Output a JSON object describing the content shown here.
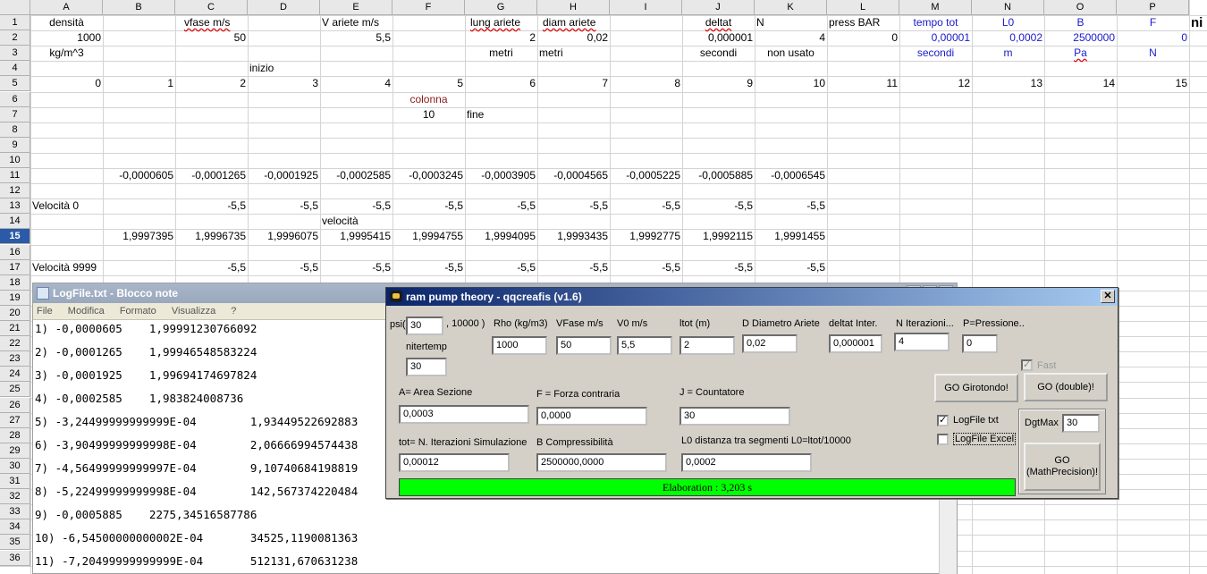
{
  "sheet": {
    "col_headers": [
      "A",
      "B",
      "C",
      "D",
      "E",
      "F",
      "G",
      "H",
      "I",
      "J",
      "K",
      "L",
      "M",
      "N",
      "O",
      "P"
    ],
    "row_headers": [
      "1",
      "2",
      "3",
      "4",
      "5",
      "6",
      "7",
      "8",
      "9",
      "10",
      "11",
      "12",
      "13",
      "14",
      "15",
      "16",
      "17",
      "18",
      "19",
      "20",
      "21",
      "22",
      "23",
      "24",
      "25",
      "26",
      "27",
      "28",
      "29",
      "30",
      "31",
      "32",
      "33",
      "34",
      "35",
      "36"
    ],
    "selected_row": "15",
    "r1": {
      "a": "densità",
      "c": "vfase m/s",
      "e": "V ariete m/s",
      "g": "lung ariete",
      "h": "diam ariete",
      "j": "deltat",
      "k": "N",
      "l": "press BAR",
      "m": "tempo tot",
      "n": "L0",
      "o": "B",
      "p": "F",
      "q": "ni"
    },
    "r2": {
      "a": "1000",
      "c": "50",
      "e": "5,5",
      "g": "2",
      "h": "0,02",
      "j": "0,000001",
      "k": "4",
      "l": "0",
      "m": "0,00001",
      "n": "0,0002",
      "o": "2500000",
      "p": "0"
    },
    "r3": {
      "a": "kg/m^3",
      "g": "metri",
      "h": "metri",
      "j": "secondi",
      "k": "non usato",
      "m": "secondi",
      "n": "m",
      "o": "Pa",
      "p": "N"
    },
    "r4": {
      "d": "inizio"
    },
    "r5": [
      "0",
      "1",
      "2",
      "3",
      "4",
      "5",
      "6",
      "7",
      "8",
      "9",
      "10",
      "11",
      "12",
      "13",
      "14",
      "15"
    ],
    "r6": {
      "f": "colonna"
    },
    "r7": {
      "f": "10",
      "g": "fine"
    },
    "r11": [
      "-0,0000605",
      "-0,0001265",
      "-0,0001925",
      "-0,0002585",
      "-0,0003245",
      "-0,0003905",
      "-0,0004565",
      "-0,0005225",
      "-0,0005885",
      "-0,0006545"
    ],
    "r13": {
      "label": "Velocità 0",
      "values": [
        "-5,5",
        "-5,5",
        "-5,5",
        "-5,5",
        "-5,5",
        "-5,5",
        "-5,5",
        "-5,5",
        "-5,5"
      ]
    },
    "r14": {
      "e": "velocità"
    },
    "r15": [
      "1,9997395",
      "1,9996735",
      "1,9996075",
      "1,9995415",
      "1,9994755",
      "1,9994095",
      "1,9993435",
      "1,9992775",
      "1,9992115",
      "1,9991455"
    ],
    "r17": {
      "label": "Velocità 9999",
      "values": [
        "-5,5",
        "-5,5",
        "-5,5",
        "-5,5",
        "-5,5",
        "-5,5",
        "-5,5",
        "-5,5",
        "-5,5"
      ]
    }
  },
  "notepad": {
    "title": "LogFile.txt - Blocco note",
    "menu": [
      "File",
      "Modifica",
      "Formato",
      "Visualizza",
      "?"
    ],
    "lines": [
      "1) -0,0000605    1,99991230766092",
      "2) -0,0001265    1,99946548583224",
      "3) -0,0001925    1,99694174697824",
      "4) -0,0002585    1,983824008736",
      "5) -3,24499999999999E-04        1,93449522692883",
      "6) -3,90499999999998E-04        2,06666994574438",
      "7) -4,56499999999997E-04        9,10740684198819",
      "8) -5,22499999999998E-04        142,567374220484",
      "9) -0,0005885    2275,34516587786",
      "10) -6,54500000000002E-04       34525,1190081363",
      "11) -7,20499999999999E-04       512131,670631238"
    ]
  },
  "dialog": {
    "title": "ram pump theory - qqcreafis (v1.6)",
    "close": "✕",
    "psi_label": "psi(",
    "psi_value": "30",
    "psi_suffix": ", 10000  )",
    "nitertemp_label": "nitertemp",
    "nitertemp_value": "30",
    "rho_label": "Rho  (kg/m3)",
    "rho_value": "1000",
    "vfase_label": "VFase m/s",
    "vfase_value": "50",
    "v0_label": "V0 m/s",
    "v0_value": "5,5",
    "ltot_label": "ltot (m)",
    "ltot_value": "2",
    "diam_label": "D Diametro Ariete",
    "diam_value": "0,02",
    "deltat_label": "deltat  Inter.",
    "deltat_value": "0,000001",
    "niter_label": "N Iterazioni...",
    "niter_value": "4",
    "press_label": "P=Pressione..",
    "press_value": "0",
    "fast_label": "Fast",
    "area_label": "A= Area Sezione",
    "area_value": "0,0003",
    "forza_label": "F = Forza contraria",
    "forza_value": "0,0000",
    "count_label": "J = Countatore",
    "count_value": "30",
    "tot_label": "tot= N.  Iterazioni Simulazione",
    "tot_value": "0,00012",
    "compr_label": "B Compressibilità",
    "compr_value": "2500000,0000",
    "l0_label": "L0 distanza tra segmenti L0=ltot/10000",
    "l0_value": "0,0002",
    "go_girotondo": "GO Girotondo!",
    "go_double": "GO (double)!",
    "logtxt_label": "LogFile txt",
    "logexcel_label": "LogFile Excel",
    "dgtmax_label": "DgtMax",
    "dgtmax_value": "30",
    "go_math": "GO\n(MathPrecision)!",
    "progress_text": "Elaboration : 3,203 s",
    "progress_fraction": 1.0,
    "check_mark": "✓"
  }
}
